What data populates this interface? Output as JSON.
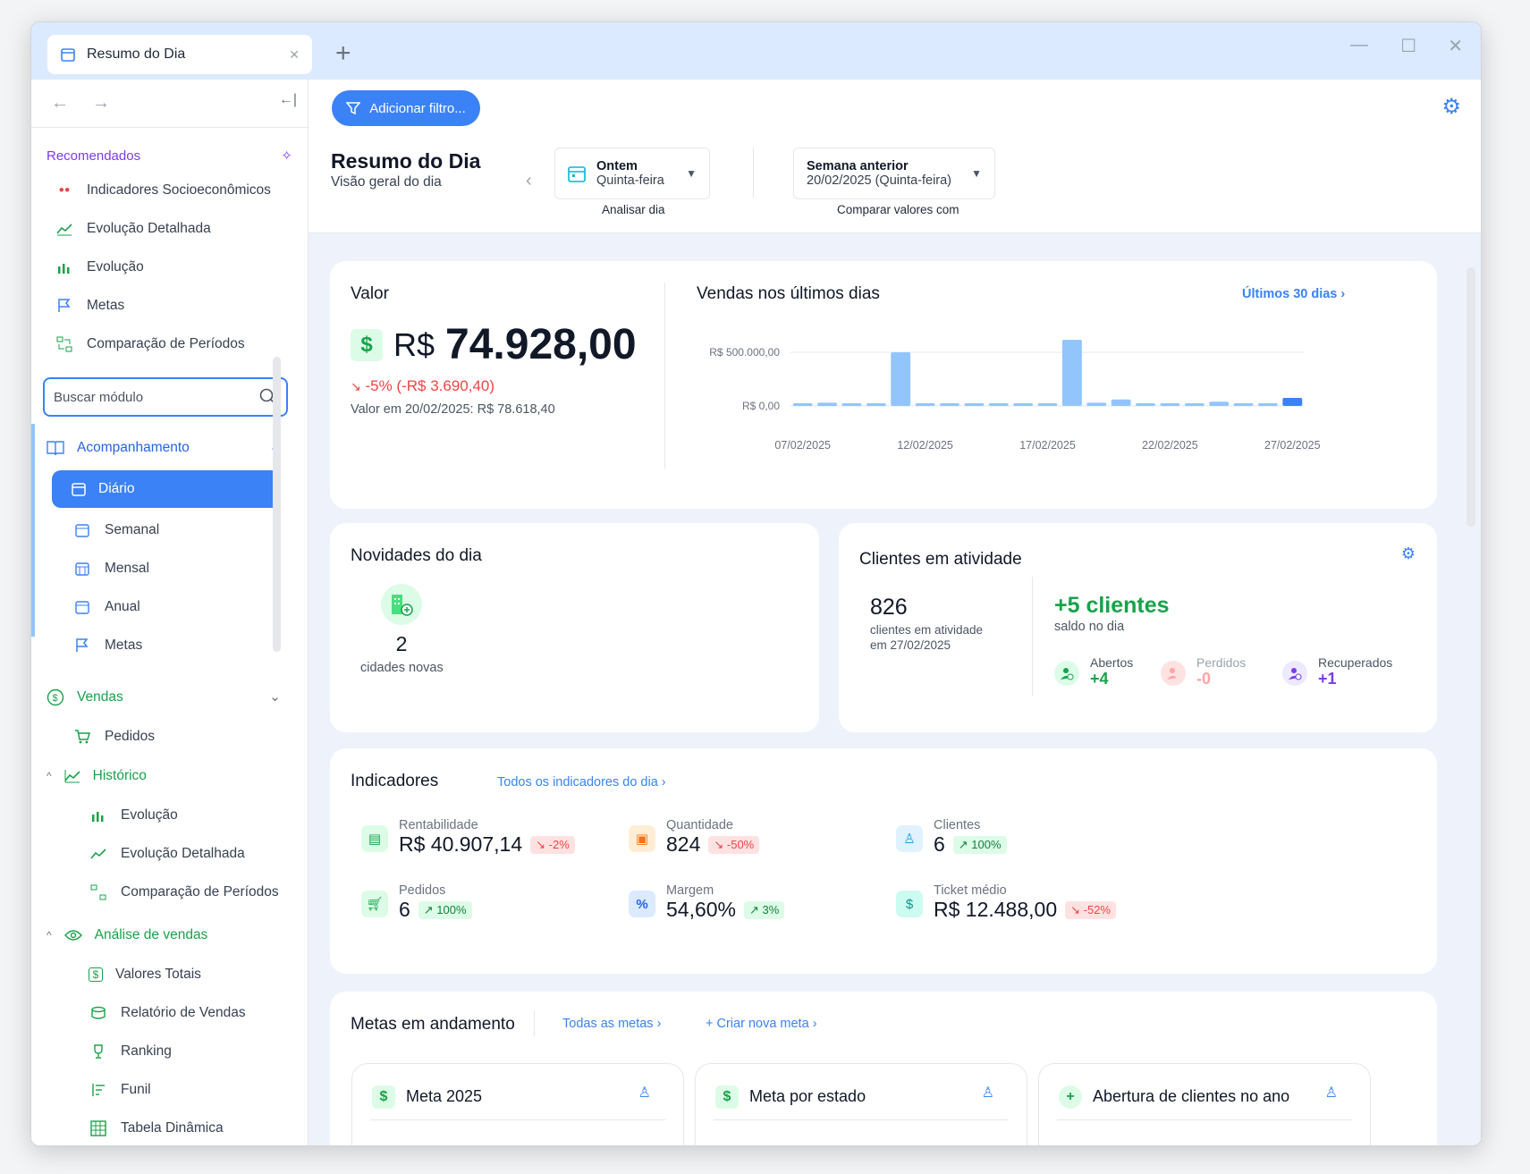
{
  "window": {
    "tab_title": "Resumo do Dia",
    "new_tab": "+",
    "minimize": "—",
    "maximize": "☐",
    "close": "✕"
  },
  "sidebar": {
    "nav_back": "←",
    "nav_forward": "→",
    "collapse": "←|",
    "recommended_title": "Recomendados",
    "recommended": [
      {
        "label": "Indicadores Socioeconômicos",
        "icon": "people-chart-icon"
      },
      {
        "label": "Evolução Detalhada",
        "icon": "line-chart-icon"
      },
      {
        "label": "Evolução",
        "icon": "bar-chart-icon"
      },
      {
        "label": "Metas",
        "icon": "flag-icon"
      },
      {
        "label": "Comparação de Períodos",
        "icon": "compare-icon"
      }
    ],
    "search_placeholder": "Buscar módulo",
    "groups": {
      "acompanhamento": {
        "label": "Acompanhamento",
        "items": [
          "Diário",
          "Semanal",
          "Mensal",
          "Anual",
          "Metas"
        ]
      },
      "vendas": {
        "label": "Vendas",
        "pedidos": "Pedidos",
        "historico": {
          "label": "Histórico",
          "items": [
            "Evolução",
            "Evolução Detalhada",
            "Comparação de Períodos"
          ]
        },
        "analise": {
          "label": "Análise de vendas",
          "items": [
            "Valores Totais",
            "Relatório de Vendas",
            "Ranking",
            "Funil",
            "Tabela Dinâmica"
          ]
        }
      }
    }
  },
  "header": {
    "filter_button": "Adicionar filtro...",
    "title": "Resumo do Dia",
    "subtitle": "Visão geral do dia",
    "day_select": {
      "main": "Ontem",
      "sub": "Quinta-feira",
      "caption": "Analisar dia"
    },
    "compare_select": {
      "main": "Semana anterior",
      "sub": "20/02/2025 (Quinta-feira)",
      "caption": "Comparar valores com"
    }
  },
  "valor": {
    "title": "Valor",
    "currency": "R$",
    "amount": "74.928,00",
    "change": "-5% (-R$ 3.690,40)",
    "compare_label": "Valor em  20/02/2025: R$ 78.618,40",
    "accent": "#ef4444"
  },
  "sales_chart": {
    "title": "Vendas nos últimos dias",
    "link": "Últimos 30 dias"
  },
  "chart_data": {
    "type": "bar",
    "title": "Vendas nos últimos dias",
    "xlabel": "",
    "ylabel": "",
    "y_tick_labels": [
      "R$ 500.000,00",
      "R$ 0,00"
    ],
    "y_ticks": [
      500000,
      0
    ],
    "ylim": [
      0,
      500000
    ],
    "x_tick_labels": [
      "07/02/2025",
      "12/02/2025",
      "17/02/2025",
      "22/02/2025",
      "27/02/2025"
    ],
    "categories": [
      "07/02/2025",
      "08/02/2025",
      "09/02/2025",
      "10/02/2025",
      "11/02/2025",
      "12/02/2025",
      "13/02/2025",
      "14/02/2025",
      "15/02/2025",
      "16/02/2025",
      "17/02/2025",
      "18/02/2025",
      "19/02/2025",
      "20/02/2025",
      "21/02/2025",
      "22/02/2025",
      "23/02/2025",
      "24/02/2025",
      "25/02/2025",
      "26/02/2025",
      "27/02/2025"
    ],
    "values": [
      15000,
      30000,
      5000,
      10000,
      500000,
      25000,
      10000,
      10000,
      15000,
      20000,
      25000,
      620000,
      30000,
      60000,
      8000,
      20000,
      6000,
      40000,
      25000,
      15000,
      74928
    ],
    "highlight_index": 20,
    "colors": {
      "bar": "#93c5fd",
      "highlight": "#3b82f6"
    },
    "grid": true
  },
  "novidades": {
    "title": "Novidades do dia",
    "count": "2",
    "label": "cidades novas"
  },
  "clientes": {
    "title": "Clientes em atividade",
    "total": "826",
    "total_label_1": "clientes em atividade",
    "total_label_2": "em 27/02/2025",
    "balance": "+5 clientes",
    "balance_label": "saldo no dia",
    "stats": [
      {
        "label": "Abertos",
        "value": "+4",
        "color": "#16a34a"
      },
      {
        "label": "Perdidos",
        "value": "-0",
        "color": "#fca5a5"
      },
      {
        "label": "Recuperados",
        "value": "+1",
        "color": "#7c3aed"
      }
    ]
  },
  "indicadores": {
    "title": "Indicadores",
    "link": "Todos os indicadores do dia",
    "items": [
      {
        "label": "Rentabilidade",
        "value": "R$ 40.907,14",
        "delta": "↘ -2%",
        "trend": "down"
      },
      {
        "label": "Quantidade",
        "value": "824",
        "delta": "↘ -50%",
        "trend": "down"
      },
      {
        "label": "Clientes",
        "value": "6",
        "delta": "↗ 100%",
        "trend": "up"
      },
      {
        "label": "Pedidos",
        "value": "6",
        "delta": "↗ 100%",
        "trend": "up"
      },
      {
        "label": "Margem",
        "value": "54,60%",
        "delta": "↗ 3%",
        "trend": "up"
      },
      {
        "label": "Ticket médio",
        "value": "R$ 12.488,00",
        "delta": "↘ -52%",
        "trend": "down"
      }
    ]
  },
  "metas": {
    "title": "Metas em andamento",
    "link_all": "Todas as metas",
    "link_new": "+ Criar nova meta",
    "cards": [
      "Meta 2025",
      "Meta por estado",
      "Abertura de clientes no ano"
    ]
  }
}
